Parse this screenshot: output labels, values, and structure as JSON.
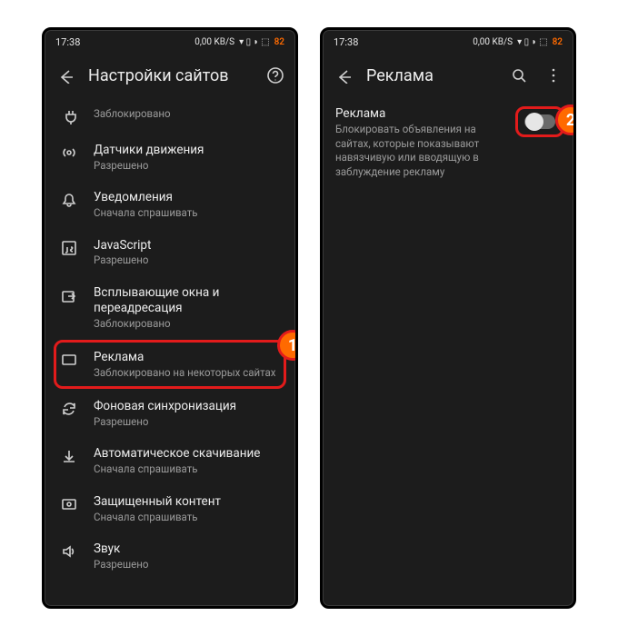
{
  "status": {
    "time": "17:38",
    "net": "0,00 KB/S",
    "battery": "82"
  },
  "screen1": {
    "title": "Настройки сайтов",
    "rows": [
      {
        "icon": "plug",
        "title": "",
        "sub": "Заблокировано"
      },
      {
        "icon": "motion",
        "title": "Датчики движения",
        "sub": "Разрешено"
      },
      {
        "icon": "bell",
        "title": "Уведомления",
        "sub": "Сначала спрашивать"
      },
      {
        "icon": "js",
        "title": "JavaScript",
        "sub": "Разрешено"
      },
      {
        "icon": "popup",
        "title": "Всплывающие окна и переадресация",
        "sub": "Заблокировано"
      },
      {
        "icon": "ads",
        "title": "Реклама",
        "sub": "Заблокировано на некоторых сайтах"
      },
      {
        "icon": "sync",
        "title": "Фоновая синхронизация",
        "sub": "Разрешено"
      },
      {
        "icon": "download",
        "title": "Автоматическое скачивание",
        "sub": "Сначала спрашивать"
      },
      {
        "icon": "protect",
        "title": "Защищенный контент",
        "sub": "Сначала спрашивать"
      },
      {
        "icon": "sound",
        "title": "Звук",
        "sub": "Разрешено"
      }
    ]
  },
  "screen2": {
    "title": "Реклама",
    "section_title": "Реклама",
    "section_desc": "Блокировать объявления на сайтах, которые показывают навязчивую или вводящую в заблуждение рекламу"
  },
  "badges": {
    "one": "1",
    "two": "2"
  }
}
